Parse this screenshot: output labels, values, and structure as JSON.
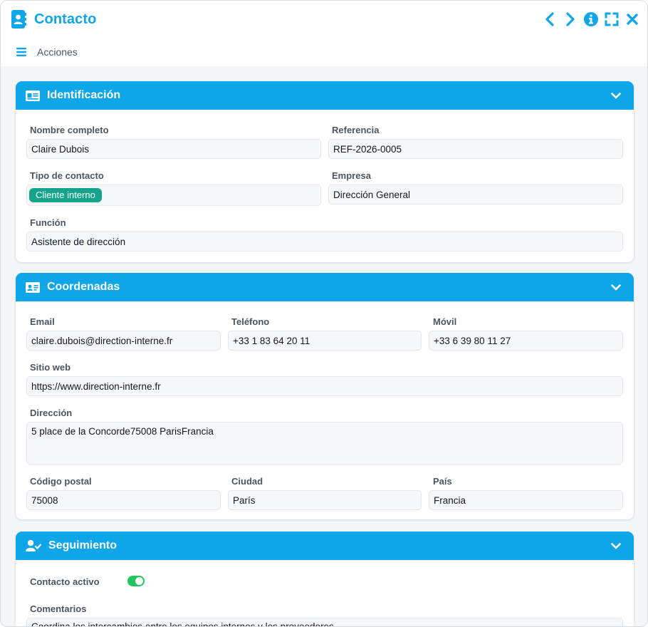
{
  "window": {
    "title": "Contacto",
    "icons": [
      "contact-book-icon",
      "chevron-left-icon",
      "chevron-right-icon",
      "info-icon",
      "fullscreen-icon",
      "close-icon"
    ],
    "accent_color": "#0ea5e9"
  },
  "menubar": {
    "label": "Acciones",
    "icon": "hamburger-icon"
  },
  "identificacion": {
    "title": "Identificación",
    "icon": "id-card-icon",
    "fields": {
      "nombre_label": "Nombre completo",
      "nombre_value": "Claire Dubois",
      "referencia_label": "Referencia",
      "referencia_value": "REF-2026-0005",
      "tipo_label": "Tipo de contacto",
      "tipo_value": "Cliente interno",
      "tipo_color": "#14a38b",
      "empresa_label": "Empresa",
      "empresa_value": "Dirección General",
      "funcion_label": "Función",
      "funcion_value": "Asistente de dirección"
    }
  },
  "coordenadas": {
    "title": "Coordenadas",
    "icon": "address-card-icon",
    "fields": {
      "email_label": "Email",
      "email_value": "claire.dubois@direction-interne.fr",
      "telefono_label": "Teléfono",
      "telefono_value": "+33 1 83 64 20 11",
      "movil_label": "Móvil",
      "movil_value": "+33 6 39 80 11 27",
      "web_label": "Sitio web",
      "web_value": "https://www.direction-interne.fr",
      "direccion_label": "Dirección",
      "direccion_lines": [
        "5 place de la Concorde",
        "75008 Paris",
        "Francia"
      ],
      "cp_label": "Código postal",
      "cp_value": "75008",
      "ciudad_label": "Ciudad",
      "ciudad_value": "París",
      "pais_label": "País",
      "pais_value": "Francia"
    }
  },
  "seguimiento": {
    "title": "Seguimiento",
    "icon": "user-check-icon",
    "fields": {
      "activo_label": "Contacto activo",
      "activo_value": true,
      "comentarios_label": "Comentarios",
      "comentarios_value": "Coordina los intercambios entre los equipos internos y los proveedores"
    }
  }
}
